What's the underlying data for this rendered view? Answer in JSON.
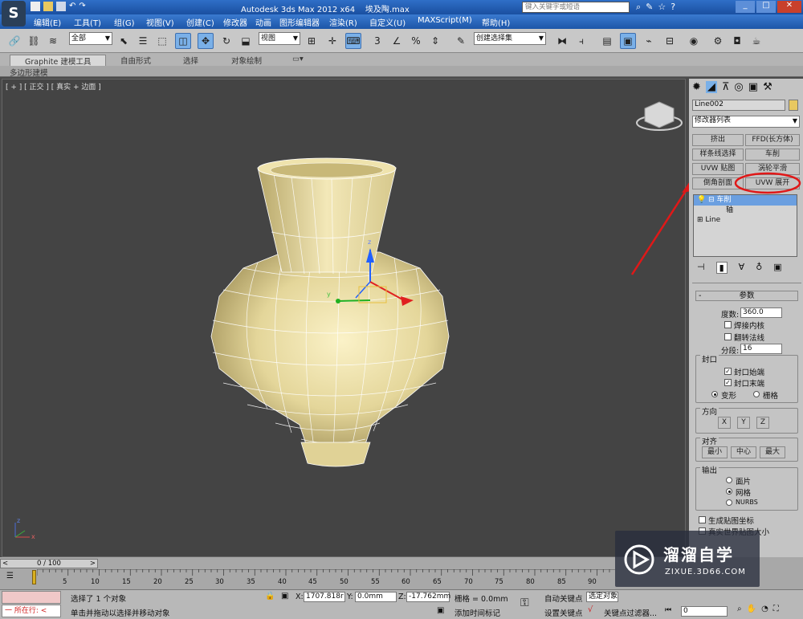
{
  "title": {
    "app": "Autodesk 3ds Max  2012 x64",
    "file": "埃及陶.max",
    "search_placeholder": "键入关键字或短语"
  },
  "menu": [
    "编辑(E)",
    "工具(T)",
    "组(G)",
    "视图(V)",
    "创建(C)",
    "修改器",
    "动画",
    "图形编辑器",
    "渲染(R)",
    "自定义(U)",
    "MAXScript(M)",
    "帮助(H)"
  ],
  "toolbar": {
    "selection_filter": "全部",
    "ref_coord": "视图",
    "named_selection": "创建选择集",
    "snap3": "3",
    "snap_pct": "%"
  },
  "ribbon": {
    "tabs": [
      "Graphite 建模工具",
      "自由形式",
      "选择",
      "对象绘制"
    ],
    "sub": "多边形建模"
  },
  "viewport": {
    "label": "[ + ] [ 正交 ] [ 真实 + 边面 ]",
    "axis_y": "y",
    "axis_z": "z",
    "axis_x": "x"
  },
  "panel": {
    "object_name": "Line002",
    "modifier_list": "修改器列表",
    "buttons": [
      "挤出",
      "FFD(长方体)",
      "样条线选择",
      "车削",
      "UVW 贴图",
      "涡轮平滑",
      "倒角剖面",
      "UVW 展开"
    ],
    "stack": [
      "车削",
      "轴",
      "Line"
    ],
    "params_title": "参数",
    "degrees_label": "度数:",
    "degrees_value": "360.0",
    "weld_core": "焊接内核",
    "flip_normals": "翻转法线",
    "segments_label": "分段:",
    "segments_value": "16",
    "capping_title": "封口",
    "cap_start": "封口始端",
    "cap_end": "封口末端",
    "morph": "变形",
    "grid": "栅格",
    "direction_title": "方向",
    "dir_x": "X",
    "dir_y": "Y",
    "dir_z": "Z",
    "align_title": "对齐",
    "align_min": "最小",
    "align_center": "中心",
    "align_max": "最大",
    "output_title": "输出",
    "out_patch": "面片",
    "out_mesh": "网格",
    "out_nurbs": "NURBS",
    "gen_map": "生成贴图坐标",
    "real_world": "真实世界贴图大小"
  },
  "timeline": {
    "frame": "0 / 100",
    "ticks": [
      "0",
      "5",
      "10",
      "15",
      "20",
      "25",
      "30",
      "35",
      "40",
      "45",
      "50",
      "55",
      "60",
      "65",
      "70",
      "75",
      "80",
      "85",
      "90"
    ]
  },
  "status": {
    "mode": "所在行:",
    "selected": "选择了 1 个对象",
    "hint": "单击并拖动以选择并移动对象",
    "x_label": "X:",
    "x_value": "1707.818r",
    "y_label": "Y:",
    "y_value": "0.0mm",
    "z_label": "Z:",
    "z_value": "-17.762mm",
    "grid": "栅格 = 0.0mm",
    "auto_key": "自动关键点",
    "set_key": "设置关键点",
    "add_time_tag": "添加时间标记",
    "selected_obj": "选定对象",
    "key_filter": "关键点过滤器...",
    "frame_field": "0"
  },
  "watermark": {
    "brand": "溜溜自学",
    "url": "ZIXUE.3D66.COM"
  },
  "colors": {
    "mesh": "#ece0a8",
    "annotation": "#e01818",
    "viewport_bg": "#444444"
  }
}
